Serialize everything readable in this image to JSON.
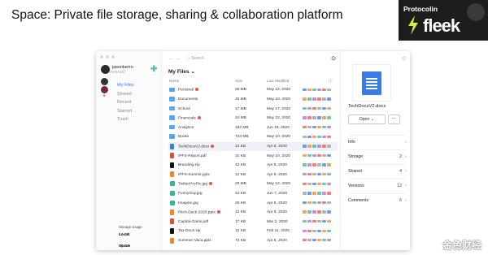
{
  "slide": {
    "title": "Space: Private file storage, sharing & collaboration platform"
  },
  "brand": {
    "presenter": "Protocolin",
    "logo": "fleek",
    "bolt_color": "#c9f24a"
  },
  "colors": {
    "accent": "#3a6fe8",
    "folder": "#57a7f0",
    "doc": "#3a7be8",
    "pdf": "#e24c3b",
    "zip": "#111111",
    "pptx": "#e8892b",
    "image": "#3bb58b",
    "badge": "#e5564a"
  },
  "sidebar": {
    "user_name": "jasonkerro",
    "user_plan": "Personal",
    "new_icon": "plus-icon",
    "nav": [
      {
        "label": "My Files",
        "active": true
      },
      {
        "label": "Shared",
        "active": false
      },
      {
        "label": "Recent",
        "active": false
      },
      {
        "label": "Starred",
        "active": false
      },
      {
        "label": "Trash",
        "active": false
      }
    ],
    "storage": {
      "title": "Storage Usage",
      "local_label": "Local",
      "local_value": "14 GB",
      "space_label": "Space",
      "space_value": "26 GB"
    }
  },
  "toolbar": {
    "search_placeholder": "Search"
  },
  "breadcrumb": "My Files ⌄",
  "table": {
    "headers": {
      "name": "Name",
      "size": "Size",
      "modified": "Last Modified"
    },
    "rows": [
      {
        "type": "folder",
        "name": "Personal",
        "badge": true,
        "size": "26 MB",
        "modified": "May 12, 2020",
        "selected": false
      },
      {
        "type": "folder",
        "name": "Documents",
        "badge": false,
        "size": "45 MB",
        "modified": "May 10, 2020",
        "selected": false
      },
      {
        "type": "folder",
        "name": "School",
        "badge": false,
        "size": "17 MB",
        "modified": "May 17, 2020",
        "selected": false
      },
      {
        "type": "folder",
        "name": "Financials",
        "badge": true,
        "size": "24 MB",
        "modified": "May 22, 2020",
        "selected": false
      },
      {
        "type": "folder",
        "name": "Analytics",
        "badge": false,
        "size": "182 MB",
        "modified": "Jun 19, 2020",
        "selected": false
      },
      {
        "type": "folder",
        "name": "Books",
        "badge": false,
        "size": "723 MB",
        "modified": "May 10, 2020",
        "selected": false
      },
      {
        "type": "doc",
        "name": "TechDocsV2.docx",
        "badge": true,
        "size": "12 KB",
        "modified": "Apr 6, 2020",
        "selected": true
      },
      {
        "type": "pdf",
        "name": "IPFS-Report.pdf",
        "badge": false,
        "size": "31 KB",
        "modified": "May 10, 2020",
        "selected": false
      },
      {
        "type": "zip",
        "name": "Branding.zip",
        "badge": false,
        "size": "42 KB",
        "modified": "Apr 8, 2020",
        "selected": false
      },
      {
        "type": "pptx",
        "name": "IPFS-Summit.pptx",
        "badge": false,
        "size": "12 KB",
        "modified": "Apr 9, 2020",
        "selected": false
      },
      {
        "type": "img",
        "name": "TwitterProPic.jpg",
        "badge": true,
        "size": "29 MB",
        "modified": "May 12, 2020",
        "selected": false
      },
      {
        "type": "img",
        "name": "FunnyGuy.jpg",
        "badge": false,
        "size": "12 KB",
        "modified": "Jun 7, 2020",
        "selected": false
      },
      {
        "type": "img",
        "name": "Imagine.jpg",
        "badge": false,
        "size": "25 KB",
        "modified": "Apr 6, 2020",
        "selected": false
      },
      {
        "type": "pptx",
        "name": "Pitch-Deck-2020.pptx",
        "badge": true,
        "size": "12 KB",
        "modified": "Apr 6, 2020",
        "selected": false
      },
      {
        "type": "pdf",
        "name": "Capital-Gains.pdf",
        "badge": false,
        "size": "17 KB",
        "modified": "Mar 2, 2020",
        "selected": false
      },
      {
        "type": "zip",
        "name": "Tax-Docs.zip",
        "badge": false,
        "size": "12 KB",
        "modified": "Feb 11, 2020",
        "selected": false
      },
      {
        "type": "pptx",
        "name": "Summer-Vaca.pptx",
        "badge": false,
        "size": "72 KB",
        "modified": "Apr 6, 2020",
        "selected": false
      }
    ]
  },
  "detail": {
    "file_name": "TechDocsV2.docx",
    "open_label": "Open ⌄",
    "more_label": "...",
    "properties": [
      {
        "label": "Info",
        "value": ""
      },
      {
        "label": "Storage",
        "value": "2"
      },
      {
        "label": "Shared",
        "value": "4"
      },
      {
        "label": "Versions",
        "value": "12"
      },
      {
        "label": "Comments",
        "value": "6"
      }
    ]
  },
  "watermark": "金色财经"
}
